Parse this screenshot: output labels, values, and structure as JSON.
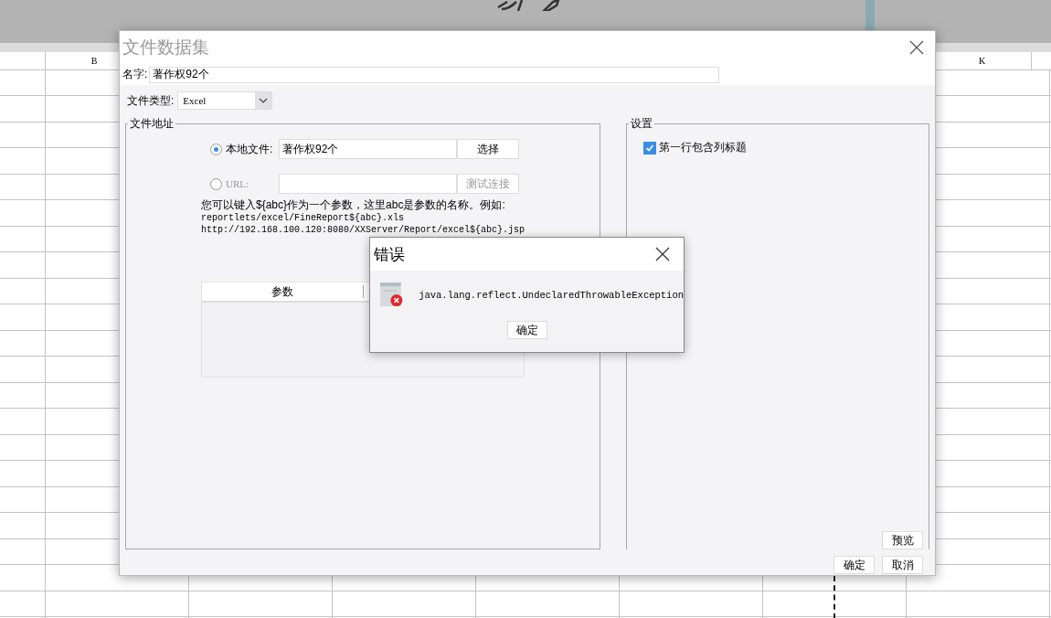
{
  "sheet": {
    "columns": [
      {
        "label": "B"
      },
      {
        "label": "K"
      }
    ]
  },
  "dialog": {
    "title": "文件数据集",
    "name_label": "名字:",
    "name_value": "著作权92个",
    "type_label": "文件类型:",
    "type_value": "Excel",
    "address_group": {
      "title": "文件地址",
      "options": [
        {
          "label": "本地文件:",
          "selected": true,
          "value": "著作权92个",
          "button": "选择",
          "button_disabled": false
        },
        {
          "label": "URL:",
          "selected": false,
          "button": "测试连接",
          "button_disabled": true
        }
      ],
      "hint_lines": [
        "您可以键入${abc}作为一个参数，这里abc是参数的名称。例如:",
        "reportlets/excel/FineReport${abc}.xls",
        "http://192.168.100.120:8080/XXServer/Report/excel${abc}.jsp"
      ],
      "params_table": {
        "columns": [
          "参数"
        ]
      }
    },
    "settings_group": {
      "title": "设置",
      "options": [
        {
          "label": "第一行包含列标题",
          "checked": true
        }
      ]
    },
    "preview_button": "预览",
    "buttons": [
      "确定",
      "取消"
    ]
  },
  "error_dialog": {
    "title": "错误",
    "message": "java.lang.reflect.UndeclaredThrowableException",
    "button": "确定"
  }
}
